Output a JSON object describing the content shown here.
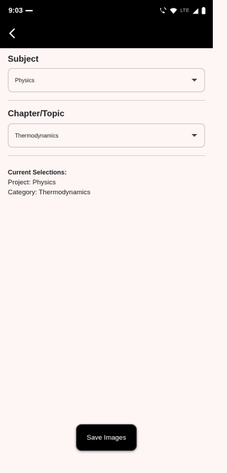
{
  "status_bar": {
    "time": "9:03",
    "network": "LTE"
  },
  "subject": {
    "label": "Subject",
    "selected": "Physics"
  },
  "chapter": {
    "label": "Chapter/Topic",
    "selected": "Thermodynamics"
  },
  "summary": {
    "title": "Current Selections:",
    "project_line": "Project: Physics",
    "category_line": "Category: Thermodynamics"
  },
  "actions": {
    "save_label": "Save Images"
  },
  "colors": {
    "background": "#fdf6f5",
    "app_bar": "#000000",
    "button": "#000000"
  }
}
